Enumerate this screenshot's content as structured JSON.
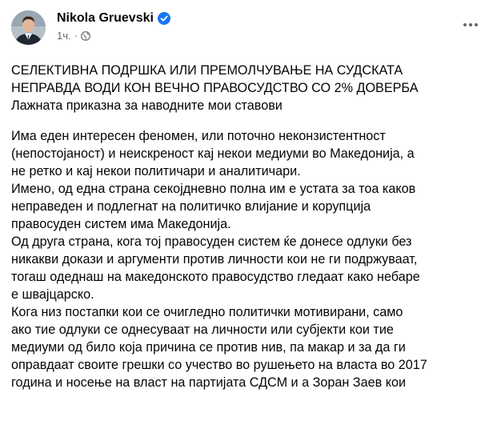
{
  "post": {
    "author": "Nikola Gruevski",
    "time": "1ч.",
    "dot": "·",
    "title_lines": [
      "СЕЛЕКТИВНА ПОДРШКА ИЛИ ПРЕМОЛЧУВАЊЕ НА СУДСКАТА",
      "НЕПРАВДА ВОДИ КОН ВЕЧНО ПРАВОСУДСТВО СО 2% ДОВЕРБА"
    ],
    "subtitle": "Лажната приказна за наводните мои ставови",
    "body_lines": [
      "Има еден интересен феномен, или поточно неконзистентност",
      "(непостојаност) и неискреност кај некои медиуми во Македонија, а",
      "не ретко и кај некои политичари и аналитичари.",
      "Имено,  од една страна секојдневно полна им е устата за тоа каков",
      "неправеден и подлегнат на политичко влијание и корупција",
      "правосуден систем има Македонија.",
      "Од друга страна, кога тој правосуден систем ќе донесе одлуки без",
      "никакви докази и аргументи против личности кои не ги подржуваат,",
      "тогаш одеднаш на македонското правосудство гледаат како небаре",
      "е швајцарско.",
      "Кога низ постапки кои се очигледно политички мотивирани, само",
      "ако тие одлуки се однесуваат на личности или субјекти кои тие",
      "медиуми од било која причина се против нив, па макар и за да ги",
      "оправдаат своите грешки со учество во рушењето на власта во 2017",
      "година и носење на власт на партијата СДСМ и а Зоран Заев кои"
    ]
  },
  "icons": {
    "verified": "verified-badge-icon",
    "audience": "globe-icon",
    "more": "more-options-icon"
  },
  "colors": {
    "text": "#050505",
    "secondary": "#65676b",
    "verified": "#1877f2"
  }
}
